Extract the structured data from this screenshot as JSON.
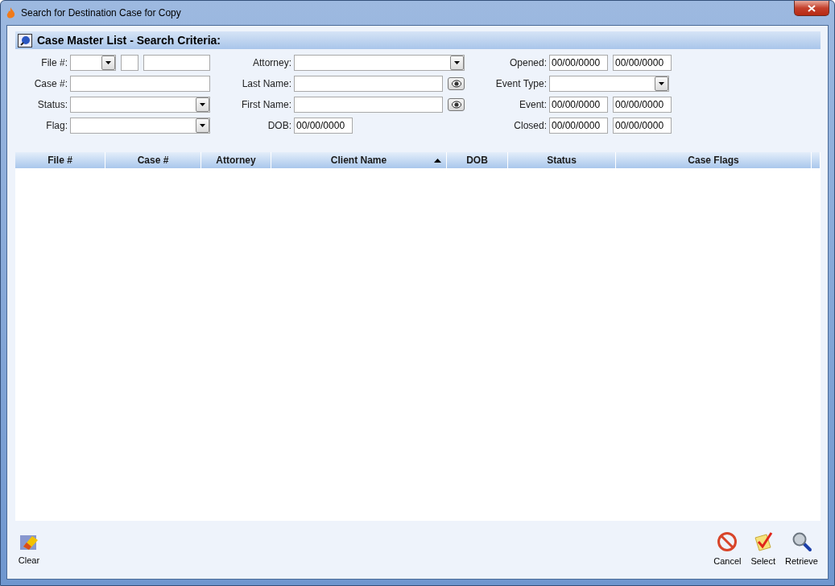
{
  "window": {
    "title": "Search for Destination Case for Copy"
  },
  "panel": {
    "title": "Case Master List - Search Criteria:"
  },
  "criteria": [
    [
      {
        "label": "File #:",
        "kind": "file_number"
      },
      {
        "label": "Attorney:",
        "kind": "combo"
      },
      {
        "label": "Opened:",
        "kind": "date_range",
        "values": [
          "00/00/0000",
          "00/00/0000"
        ]
      }
    ],
    [
      {
        "label": "Case #:",
        "kind": "text"
      },
      {
        "label": "Last Name:",
        "kind": "name"
      },
      {
        "label": "Event Type:",
        "kind": "combo"
      }
    ],
    [
      {
        "label": "Status:",
        "kind": "combo"
      },
      {
        "label": "First Name:",
        "kind": "name"
      },
      {
        "label": "Event:",
        "kind": "date_range",
        "values": [
          "00/00/0000",
          "00/00/0000"
        ]
      }
    ],
    [
      {
        "label": "Flag:",
        "kind": "combo"
      },
      {
        "label": "DOB:",
        "kind": "date",
        "values": [
          "00/00/0000"
        ]
      },
      {
        "label": "Closed:",
        "kind": "date_range",
        "values": [
          "00/00/0000",
          "00/00/0000"
        ]
      }
    ]
  ],
  "table": {
    "columns": [
      {
        "label": "File #",
        "sorted": false
      },
      {
        "label": "Case #",
        "sorted": false
      },
      {
        "label": "Attorney",
        "sorted": false
      },
      {
        "label": "Client Name",
        "sorted": true
      },
      {
        "label": "DOB",
        "sorted": false
      },
      {
        "label": "Status",
        "sorted": false
      },
      {
        "label": "Case Flags",
        "sorted": false
      }
    ]
  },
  "left_buttons": [
    {
      "label": "Clear",
      "kind": "clear"
    }
  ],
  "right_buttons": [
    {
      "label": "Cancel",
      "kind": "cancel"
    },
    {
      "label": "Select",
      "kind": "select"
    },
    {
      "label": "Retrieve",
      "kind": "retrieve"
    }
  ]
}
